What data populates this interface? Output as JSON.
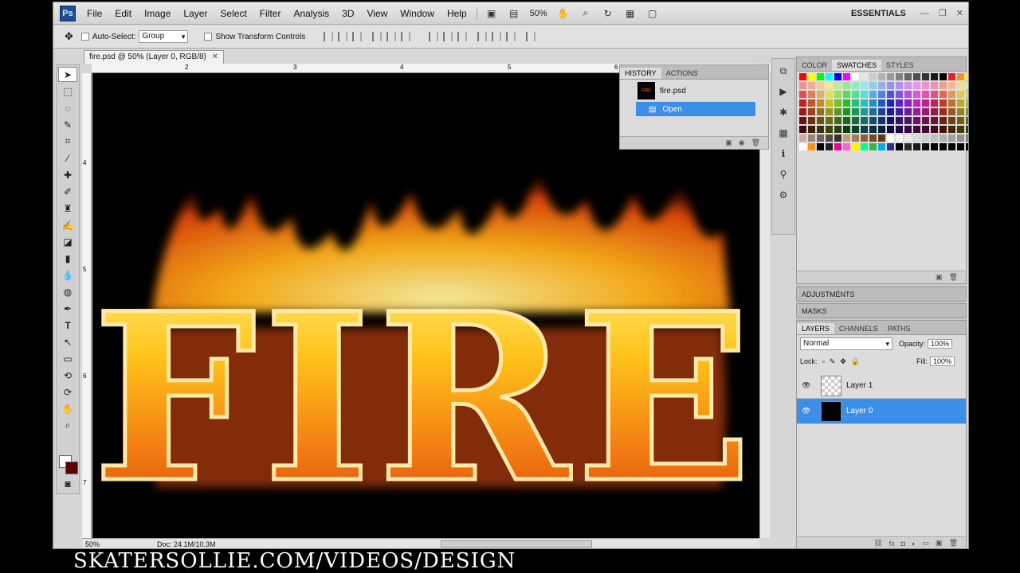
{
  "app": {
    "logo": "Ps"
  },
  "menu": {
    "items": [
      "File",
      "Edit",
      "Image",
      "Layer",
      "Select",
      "Filter",
      "Analysis",
      "3D",
      "View",
      "Window",
      "Help"
    ],
    "zoom": "50%",
    "workspace": "ESSENTIALS"
  },
  "options": {
    "auto_select_label": "Auto-Select:",
    "auto_select_value": "Group",
    "show_transform_label": "Show Transform Controls"
  },
  "document": {
    "tab_title": "fire.psd @ 50% (Layer 0, RGB/8)",
    "canvas_text": "FIRE",
    "ruler_top": [
      "2",
      "3",
      "4",
      "5",
      "6"
    ],
    "ruler_left": [
      "4",
      "5",
      "6",
      "7"
    ],
    "status_zoom": "50%",
    "status_doc": "Doc: 24.1M/10.3M"
  },
  "history": {
    "tabs": [
      "HISTORY",
      "ACTIONS"
    ],
    "snapshot_name": "fire.psd",
    "thumb_text": "FIRE",
    "state": "Open"
  },
  "swatches_panel": {
    "tabs": [
      "COLOR",
      "SWATCHES",
      "STYLES"
    ]
  },
  "adjustments": {
    "title": "ADJUSTMENTS"
  },
  "masks": {
    "title": "MASKS"
  },
  "layers_panel": {
    "tabs": [
      "LAYERS",
      "CHANNELS",
      "PATHS"
    ],
    "blend_mode": "Normal",
    "opacity_label": "Opacity:",
    "opacity_value": "100%",
    "lock_label": "Lock:",
    "fill_label": "Fill:",
    "fill_value": "100%",
    "layers": [
      {
        "name": "Layer 1",
        "selected": false
      },
      {
        "name": "Layer 0",
        "selected": true
      }
    ]
  },
  "watermark": "SKATERSOLLIE.COM/VIDEOS/DESIGN"
}
